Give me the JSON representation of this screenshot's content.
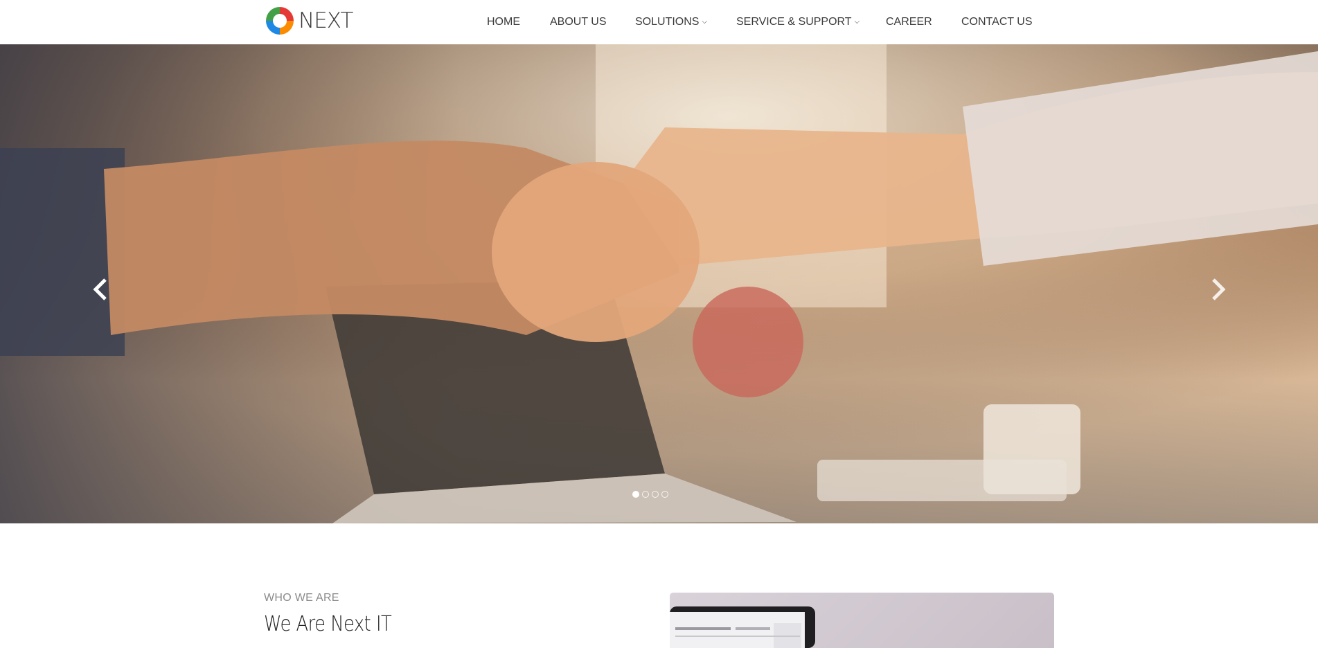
{
  "brand": {
    "name": "NEXT",
    "logo_colors": [
      "#e53935",
      "#43a047",
      "#1e88e5",
      "#fb8c00"
    ]
  },
  "nav": {
    "items": [
      {
        "label": "HOME"
      },
      {
        "label": "ABOUT US"
      },
      {
        "label": "SOLUTIONS",
        "has_dropdown": true
      },
      {
        "label": "SERVICE & SUPPORT",
        "has_dropdown": true
      },
      {
        "label": "CAREER"
      },
      {
        "label": "CONTACT US"
      }
    ],
    "dropdown_icon": "chevron-down-icon"
  },
  "hero": {
    "image": "handshake-photo",
    "prev_icon": "chevron-left-icon",
    "next_icon": "chevron-right-icon",
    "slide_count": 4,
    "active_slide": 1
  },
  "about": {
    "eyebrow": "WHO WE ARE",
    "title": "We Are Next IT",
    "image": "laptop-screen-photo"
  }
}
